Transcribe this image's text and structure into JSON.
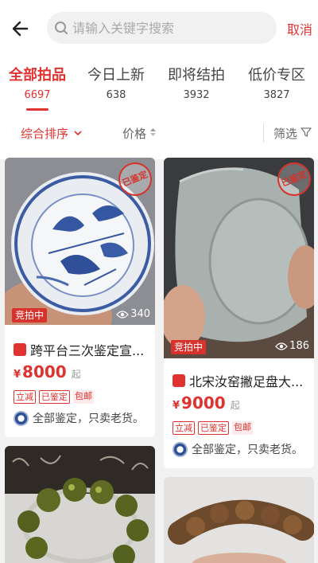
{
  "header": {
    "search_placeholder": "请输入关键字搜索",
    "cancel_label": "取消"
  },
  "tabs": [
    {
      "label": "全部拍品",
      "count": "6697",
      "active": true
    },
    {
      "label": "今日上新",
      "count": "638"
    },
    {
      "label": "即将结拍",
      "count": "3932"
    },
    {
      "label": "低价专区",
      "count": "3827"
    }
  ],
  "filters": {
    "sort_label": "综合排序",
    "price_label": "价格",
    "filter_label": "筛选"
  },
  "cards": [
    {
      "status": "竞拍中",
      "views": "340",
      "stamp": "已鉴定",
      "title": "跨平台三次鉴定宣...",
      "currency": "¥",
      "price": "8000",
      "price_suffix": "起",
      "tags": [
        "立减",
        "已鉴定",
        "包邮"
      ],
      "seller": "全部鉴定，只卖老货。"
    },
    {
      "status": "竞拍中",
      "views": "186",
      "stamp": "已鉴定",
      "title": "北宋汝窑撇足盘大...",
      "currency": "¥",
      "price": "9000",
      "price_suffix": "起",
      "tags": [
        "立减",
        "已鉴定",
        "包邮"
      ],
      "seller": "全部鉴定，只卖老货。"
    }
  ],
  "colors": {
    "accent": "#e0322f"
  }
}
